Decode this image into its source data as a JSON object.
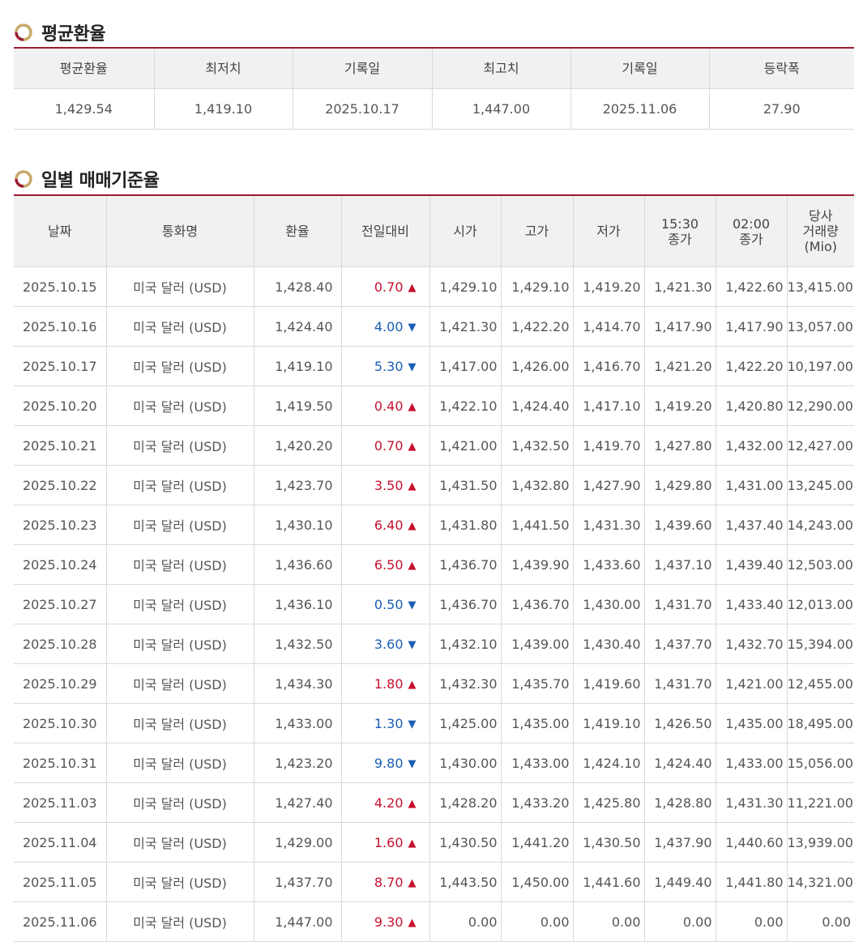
{
  "avg_section": {
    "title": "평균환율",
    "headers": [
      "평균환율",
      "최저치",
      "기록일",
      "최고치",
      "기록일",
      "등락폭"
    ],
    "values": [
      "1,429.54",
      "1,419.10",
      "2025.10.17",
      "1,447.00",
      "2025.11.06",
      "27.90"
    ]
  },
  "daily_section": {
    "title": "일별 매매기준율",
    "headers": {
      "date": "날짜",
      "currency": "통화명",
      "rate": "환율",
      "change": "전일대비",
      "open": "시가",
      "high": "고가",
      "low": "저가",
      "close1530_line1": "15:30",
      "close1530_line2": "종가",
      "close0200_line1": "02:00",
      "close0200_line2": "종가",
      "volume_line1": "당사",
      "volume_line2": "거래량",
      "volume_line3": "(Mio)"
    },
    "rows": [
      {
        "date": "2025.10.15",
        "currency": "미국 달러 (USD)",
        "rate": "1,428.40",
        "change": "0.70",
        "dir": "up",
        "open": "1,429.10",
        "high": "1,429.10",
        "low": "1,419.20",
        "close1530": "1,421.30",
        "close0200": "1,422.60",
        "volume": "13,415.00"
      },
      {
        "date": "2025.10.16",
        "currency": "미국 달러 (USD)",
        "rate": "1,424.40",
        "change": "4.00",
        "dir": "down",
        "open": "1,421.30",
        "high": "1,422.20",
        "low": "1,414.70",
        "close1530": "1,417.90",
        "close0200": "1,417.90",
        "volume": "13,057.00"
      },
      {
        "date": "2025.10.17",
        "currency": "미국 달러 (USD)",
        "rate": "1,419.10",
        "change": "5.30",
        "dir": "down",
        "open": "1,417.00",
        "high": "1,426.00",
        "low": "1,416.70",
        "close1530": "1,421.20",
        "close0200": "1,422.20",
        "volume": "10,197.00"
      },
      {
        "date": "2025.10.20",
        "currency": "미국 달러 (USD)",
        "rate": "1,419.50",
        "change": "0.40",
        "dir": "up",
        "open": "1,422.10",
        "high": "1,424.40",
        "low": "1,417.10",
        "close1530": "1,419.20",
        "close0200": "1,420.80",
        "volume": "12,290.00"
      },
      {
        "date": "2025.10.21",
        "currency": "미국 달러 (USD)",
        "rate": "1,420.20",
        "change": "0.70",
        "dir": "up",
        "open": "1,421.00",
        "high": "1,432.50",
        "low": "1,419.70",
        "close1530": "1,427.80",
        "close0200": "1,432.00",
        "volume": "12,427.00"
      },
      {
        "date": "2025.10.22",
        "currency": "미국 달러 (USD)",
        "rate": "1,423.70",
        "change": "3.50",
        "dir": "up",
        "open": "1,431.50",
        "high": "1,432.80",
        "low": "1,427.90",
        "close1530": "1,429.80",
        "close0200": "1,431.00",
        "volume": "13,245.00"
      },
      {
        "date": "2025.10.23",
        "currency": "미국 달러 (USD)",
        "rate": "1,430.10",
        "change": "6.40",
        "dir": "up",
        "open": "1,431.80",
        "high": "1,441.50",
        "low": "1,431.30",
        "close1530": "1,439.60",
        "close0200": "1,437.40",
        "volume": "14,243.00"
      },
      {
        "date": "2025.10.24",
        "currency": "미국 달러 (USD)",
        "rate": "1,436.60",
        "change": "6.50",
        "dir": "up",
        "open": "1,436.70",
        "high": "1,439.90",
        "low": "1,433.60",
        "close1530": "1,437.10",
        "close0200": "1,439.40",
        "volume": "12,503.00"
      },
      {
        "date": "2025.10.27",
        "currency": "미국 달러 (USD)",
        "rate": "1,436.10",
        "change": "0.50",
        "dir": "down",
        "open": "1,436.70",
        "high": "1,436.70",
        "low": "1,430.00",
        "close1530": "1,431.70",
        "close0200": "1,433.40",
        "volume": "12,013.00"
      },
      {
        "date": "2025.10.28",
        "currency": "미국 달러 (USD)",
        "rate": "1,432.50",
        "change": "3.60",
        "dir": "down",
        "open": "1,432.10",
        "high": "1,439.00",
        "low": "1,430.40",
        "close1530": "1,437.70",
        "close0200": "1,432.70",
        "volume": "15,394.00"
      },
      {
        "date": "2025.10.29",
        "currency": "미국 달러 (USD)",
        "rate": "1,434.30",
        "change": "1.80",
        "dir": "up",
        "open": "1,432.30",
        "high": "1,435.70",
        "low": "1,419.60",
        "close1530": "1,431.70",
        "close0200": "1,421.00",
        "volume": "12,455.00"
      },
      {
        "date": "2025.10.30",
        "currency": "미국 달러 (USD)",
        "rate": "1,433.00",
        "change": "1.30",
        "dir": "down",
        "open": "1,425.00",
        "high": "1,435.00",
        "low": "1,419.10",
        "close1530": "1,426.50",
        "close0200": "1,435.00",
        "volume": "18,495.00"
      },
      {
        "date": "2025.10.31",
        "currency": "미국 달러 (USD)",
        "rate": "1,423.20",
        "change": "9.80",
        "dir": "down",
        "open": "1,430.00",
        "high": "1,433.00",
        "low": "1,424.10",
        "close1530": "1,424.40",
        "close0200": "1,433.00",
        "volume": "15,056.00"
      },
      {
        "date": "2025.11.03",
        "currency": "미국 달러 (USD)",
        "rate": "1,427.40",
        "change": "4.20",
        "dir": "up",
        "open": "1,428.20",
        "high": "1,433.20",
        "low": "1,425.80",
        "close1530": "1,428.80",
        "close0200": "1,431.30",
        "volume": "11,221.00"
      },
      {
        "date": "2025.11.04",
        "currency": "미국 달러 (USD)",
        "rate": "1,429.00",
        "change": "1.60",
        "dir": "up",
        "open": "1,430.50",
        "high": "1,441.20",
        "low": "1,430.50",
        "close1530": "1,437.90",
        "close0200": "1,440.60",
        "volume": "13,939.00"
      },
      {
        "date": "2025.11.05",
        "currency": "미국 달러 (USD)",
        "rate": "1,437.70",
        "change": "8.70",
        "dir": "up",
        "open": "1,443.50",
        "high": "1,450.00",
        "low": "1,441.60",
        "close1530": "1,449.40",
        "close0200": "1,441.80",
        "volume": "14,321.00"
      },
      {
        "date": "2025.11.06",
        "currency": "미국 달러 (USD)",
        "rate": "1,447.00",
        "change": "9.30",
        "dir": "up",
        "open": "0.00",
        "high": "0.00",
        "low": "0.00",
        "close1530": "0.00",
        "close0200": "0.00",
        "volume": "0.00"
      }
    ]
  },
  "colors": {
    "accent": "#9b1c31",
    "up": "#c8102e",
    "down": "#1a5fb4"
  },
  "icons": {
    "up": "▲",
    "down": "▼",
    "section": "circle-logo-icon"
  }
}
